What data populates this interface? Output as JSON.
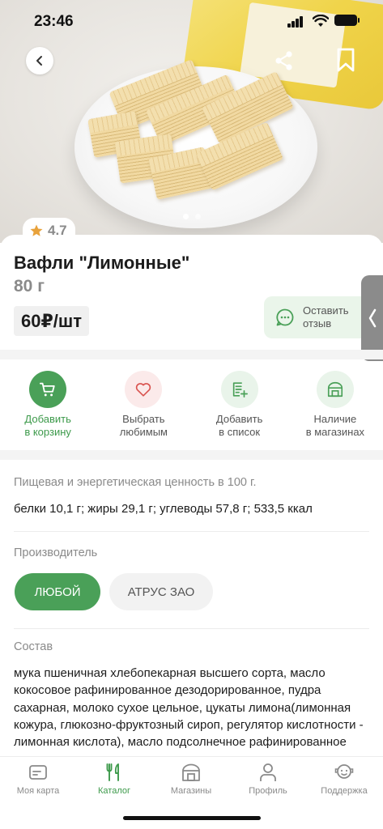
{
  "status_bar": {
    "time": "23:46"
  },
  "product": {
    "rating": "4.7",
    "title": "Вафли \"Лимонные\"",
    "weight": "80 г",
    "price": "60₽/шт",
    "review_button": {
      "line1": "Оставить",
      "line2": "отзыв"
    }
  },
  "actions": [
    {
      "line1": "Добавить",
      "line2": "в корзину",
      "icon": "cart-icon"
    },
    {
      "line1": "Выбрать",
      "line2": "любимым",
      "icon": "heart-icon"
    },
    {
      "line1": "Добавить",
      "line2": "в список",
      "icon": "list-add-icon"
    },
    {
      "line1": "Наличие",
      "line2": "в магазинах",
      "icon": "store-icon"
    }
  ],
  "nutrition": {
    "label": "Пищевая и энергетическая ценность в 100 г.",
    "value": "белки 10,1 г; жиры 29,1 г; углеводы 57,8 г; 533,5 ккал"
  },
  "manufacturer": {
    "label": "Производитель",
    "options": [
      "ЛЮБОЙ",
      "АТРУС ЗАО"
    ],
    "selected": "ЛЮБОЙ"
  },
  "composition": {
    "label": "Состав",
    "text": "мука пшеничная  хлебопекарная высшего сорта, масло кокосовое рафинированное дезодорированное, пудра сахарная, молоко сухое цельное,  цукаты лимона(лимонная кожура, глюкозно-фруктозный сироп, регулятор кислотности -  лимонная кислота), масло подсолнечное рафинированное"
  },
  "tabbar": [
    {
      "label": "Моя карта",
      "icon": "card-icon"
    },
    {
      "label": "Каталог",
      "icon": "fork-knife-icon",
      "active": true
    },
    {
      "label": "Магазины",
      "icon": "store-icon"
    },
    {
      "label": "Профиль",
      "icon": "person-icon"
    },
    {
      "label": "Поддержка",
      "icon": "support-icon"
    }
  ],
  "colors": {
    "accent": "#4aa058",
    "accent_text": "#3d9a4b",
    "muted": "#8a8a8a",
    "review_bg": "#eaf5ea"
  }
}
